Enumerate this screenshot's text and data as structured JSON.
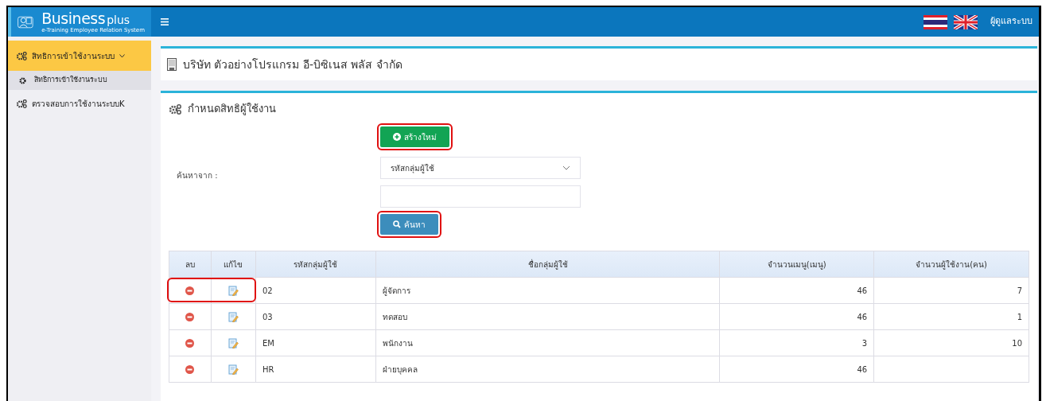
{
  "header": {
    "brand": "Business",
    "brand_suffix": "plus",
    "tagline": "e-Training Employee Relation System",
    "user": "ผู้ดูแลระบบ"
  },
  "sidebar": {
    "items": [
      {
        "label": "สิทธิการเข้าใช้งานระบบ",
        "selected": true,
        "expanded": true,
        "children": [
          {
            "label": "สิทธิการเข้าใช้งานระบบ",
            "selected": true
          }
        ]
      },
      {
        "label": "ตรวจสอบการใช้งานระบบK",
        "selected": false,
        "expanded": false
      }
    ]
  },
  "company": {
    "title": "บริษัท ตัวอย่างโปรแกรม อี-บิซิเนส พลัส จำกัด"
  },
  "panel": {
    "title": "กำหนดสิทธิผู้ใช้งาน",
    "create_button": {
      "label": "สร้างใหม่",
      "highlighted": true
    },
    "search_label": "ค้นหาจาก :",
    "search_by": "รหัสกลุ่มผู้ใช้",
    "search_button": {
      "label": "ค้นหา",
      "highlighted": true
    }
  },
  "table": {
    "columns": [
      "ลบ",
      "แก้ไข",
      "รหัสกลุ่มผู้ใช้",
      "ชื่อกลุ่มผู้ใช้",
      "จำนวนเมนู(เมนู)",
      "จำนวนผู้ใช้งาน(คน)"
    ],
    "rows": [
      {
        "code": "02",
        "name": "ผู้จัดการ",
        "menus": "46",
        "users": "7",
        "highlighted": true
      },
      {
        "code": "03",
        "name": "ทดสอบ",
        "menus": "46",
        "users": "1",
        "highlighted": false
      },
      {
        "code": "EM",
        "name": "พนักงาน",
        "menus": "3",
        "users": "10",
        "highlighted": false
      },
      {
        "code": "HR",
        "name": "ฝ่ายบุคคล",
        "menus": "46",
        "highlighted": false
      }
    ]
  }
}
